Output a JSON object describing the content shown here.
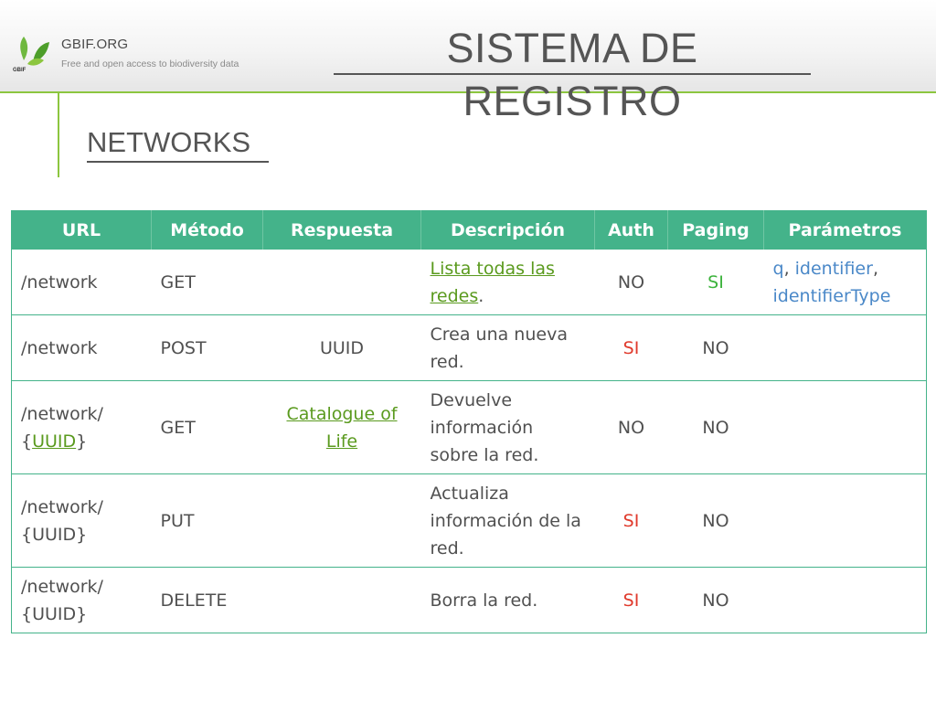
{
  "header": {
    "brand": "GBIF.ORG",
    "brand_logo_mark": "GBIF",
    "tagline": "Free and open access to biodiversity data",
    "title": "SISTEMA DE REGISTRO"
  },
  "section": {
    "title": "NETWORKS"
  },
  "colors": {
    "accent_green": "#8cc63f",
    "table_header": "#44b38a",
    "link_green": "#5a9a1e",
    "yes_green": "#3db33d",
    "yes_red": "#e03a2c",
    "param_blue": "#4a88c8"
  },
  "icons": {
    "logo": "gbif-leaf-logo-icon"
  },
  "table": {
    "headers": [
      "URL",
      "Método",
      "Respuesta",
      "Descripción",
      "Auth",
      "Paging",
      "Parámetros"
    ],
    "rows": [
      {
        "url_a": "/network",
        "url_b": "",
        "method": "GET",
        "response": "",
        "description_link": "Lista todas las redes",
        "description_suffix": ".",
        "auth": "NO",
        "paging": "SI",
        "params": [
          "q",
          "identifier",
          "identifierType"
        ]
      },
      {
        "url_a": "/network",
        "url_b": "",
        "method": "POST",
        "response": "UUID",
        "description": "Crea una nueva red.",
        "auth": "SI",
        "paging": "NO"
      },
      {
        "url_a": "/network/",
        "url_open": "{",
        "url_link": "UUID",
        "url_close": "}",
        "method": "GET",
        "response_link": "Catalogue of Life",
        "description": "Devuelve información sobre la red.",
        "auth": "NO",
        "paging": "NO"
      },
      {
        "url_a": "/network/",
        "url_b": "{UUID}",
        "method": "PUT",
        "response": "",
        "description": "Actualiza información de la red.",
        "auth": "SI",
        "paging": "NO"
      },
      {
        "url_a": "/network/",
        "url_b": "{UUID}",
        "method": "DELETE",
        "response": "",
        "description": "Borra la red.",
        "auth": "SI",
        "paging": "NO"
      }
    ]
  }
}
